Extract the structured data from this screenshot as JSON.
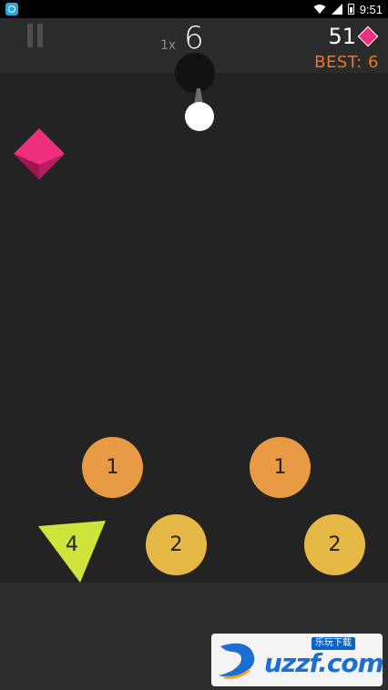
{
  "status_bar": {
    "time": "9:51",
    "icons": [
      "app-notification-icon",
      "wifi-icon",
      "signal-icon",
      "battery-icon"
    ]
  },
  "hud": {
    "score": "6",
    "multiplier": "1x",
    "gem_count": "51",
    "best": "BEST: 6"
  },
  "colors": {
    "background": "#232323",
    "hud_bar": "#2b2b2b",
    "floor": "#2e2e2e",
    "gem_pink": "#ee2f7d",
    "best_orange": "#f0732a",
    "target_orange": "#e89a44",
    "target_yellow": "#e6b946",
    "triangle_lime": "#cfe33b"
  },
  "targets": [
    {
      "shape": "circle",
      "label": "1",
      "color": "orange"
    },
    {
      "shape": "circle",
      "label": "1",
      "color": "orange"
    },
    {
      "shape": "triangle",
      "label": "4",
      "color": "lime"
    },
    {
      "shape": "circle",
      "label": "2",
      "color": "yellow"
    },
    {
      "shape": "circle",
      "label": "2",
      "color": "yellow"
    }
  ],
  "watermark": {
    "tag": "乐玩下载",
    "text": "uzzf.com"
  }
}
